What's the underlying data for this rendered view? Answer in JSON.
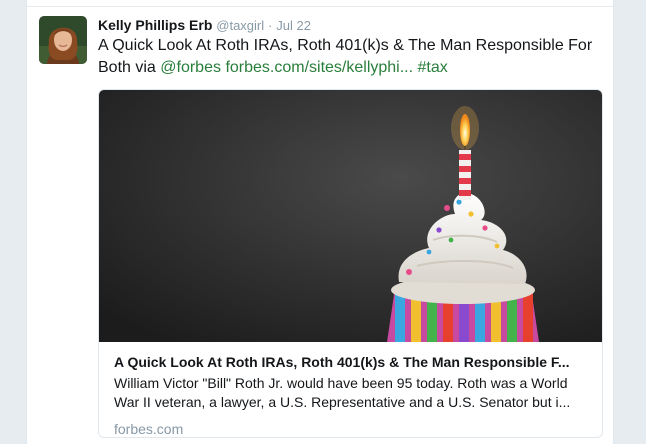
{
  "tweet": {
    "author_name": "Kelly Phillips Erb",
    "handle": "@taxgirl",
    "separator": "·",
    "timestamp": "Jul 22",
    "text_before": "A Quick Look At Roth IRAs, Roth 401(k)s & The Man Responsible For Both via ",
    "mention": "@forbes",
    "url": "forbes.com/sites/kellyphi...",
    "hashtag": "#tax"
  },
  "card": {
    "title": "A Quick Look At Roth IRAs, Roth 401(k)s & The Man Responsible F...",
    "description": "William Victor \"Bill\" Roth Jr. would have been 95 today. Roth was a World War II veteran, a lawyer, a U.S. Representative and a U.S. Senator but i...",
    "domain": "forbes.com",
    "image_subject": "cupcake with lit candle"
  },
  "colors": {
    "link": "#2a7e3b",
    "muted": "#8899a6",
    "text": "#14171a",
    "background": "#e6ecf0"
  }
}
